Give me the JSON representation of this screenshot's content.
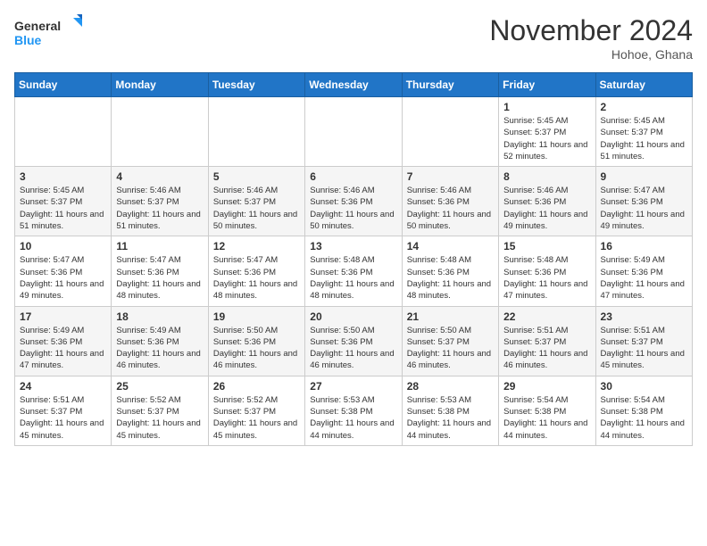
{
  "header": {
    "logo_line1": "General",
    "logo_line2": "Blue",
    "month_title": "November 2024",
    "location": "Hohoe, Ghana"
  },
  "weekdays": [
    "Sunday",
    "Monday",
    "Tuesday",
    "Wednesday",
    "Thursday",
    "Friday",
    "Saturday"
  ],
  "weeks": [
    [
      {
        "day": "",
        "sunrise": "",
        "sunset": "",
        "daylight": ""
      },
      {
        "day": "",
        "sunrise": "",
        "sunset": "",
        "daylight": ""
      },
      {
        "day": "",
        "sunrise": "",
        "sunset": "",
        "daylight": ""
      },
      {
        "day": "",
        "sunrise": "",
        "sunset": "",
        "daylight": ""
      },
      {
        "day": "",
        "sunrise": "",
        "sunset": "",
        "daylight": ""
      },
      {
        "day": "1",
        "sunrise": "Sunrise: 5:45 AM",
        "sunset": "Sunset: 5:37 PM",
        "daylight": "Daylight: 11 hours and 52 minutes."
      },
      {
        "day": "2",
        "sunrise": "Sunrise: 5:45 AM",
        "sunset": "Sunset: 5:37 PM",
        "daylight": "Daylight: 11 hours and 51 minutes."
      }
    ],
    [
      {
        "day": "3",
        "sunrise": "Sunrise: 5:45 AM",
        "sunset": "Sunset: 5:37 PM",
        "daylight": "Daylight: 11 hours and 51 minutes."
      },
      {
        "day": "4",
        "sunrise": "Sunrise: 5:46 AM",
        "sunset": "Sunset: 5:37 PM",
        "daylight": "Daylight: 11 hours and 51 minutes."
      },
      {
        "day": "5",
        "sunrise": "Sunrise: 5:46 AM",
        "sunset": "Sunset: 5:37 PM",
        "daylight": "Daylight: 11 hours and 50 minutes."
      },
      {
        "day": "6",
        "sunrise": "Sunrise: 5:46 AM",
        "sunset": "Sunset: 5:36 PM",
        "daylight": "Daylight: 11 hours and 50 minutes."
      },
      {
        "day": "7",
        "sunrise": "Sunrise: 5:46 AM",
        "sunset": "Sunset: 5:36 PM",
        "daylight": "Daylight: 11 hours and 50 minutes."
      },
      {
        "day": "8",
        "sunrise": "Sunrise: 5:46 AM",
        "sunset": "Sunset: 5:36 PM",
        "daylight": "Daylight: 11 hours and 49 minutes."
      },
      {
        "day": "9",
        "sunrise": "Sunrise: 5:47 AM",
        "sunset": "Sunset: 5:36 PM",
        "daylight": "Daylight: 11 hours and 49 minutes."
      }
    ],
    [
      {
        "day": "10",
        "sunrise": "Sunrise: 5:47 AM",
        "sunset": "Sunset: 5:36 PM",
        "daylight": "Daylight: 11 hours and 49 minutes."
      },
      {
        "day": "11",
        "sunrise": "Sunrise: 5:47 AM",
        "sunset": "Sunset: 5:36 PM",
        "daylight": "Daylight: 11 hours and 48 minutes."
      },
      {
        "day": "12",
        "sunrise": "Sunrise: 5:47 AM",
        "sunset": "Sunset: 5:36 PM",
        "daylight": "Daylight: 11 hours and 48 minutes."
      },
      {
        "day": "13",
        "sunrise": "Sunrise: 5:48 AM",
        "sunset": "Sunset: 5:36 PM",
        "daylight": "Daylight: 11 hours and 48 minutes."
      },
      {
        "day": "14",
        "sunrise": "Sunrise: 5:48 AM",
        "sunset": "Sunset: 5:36 PM",
        "daylight": "Daylight: 11 hours and 48 minutes."
      },
      {
        "day": "15",
        "sunrise": "Sunrise: 5:48 AM",
        "sunset": "Sunset: 5:36 PM",
        "daylight": "Daylight: 11 hours and 47 minutes."
      },
      {
        "day": "16",
        "sunrise": "Sunrise: 5:49 AM",
        "sunset": "Sunset: 5:36 PM",
        "daylight": "Daylight: 11 hours and 47 minutes."
      }
    ],
    [
      {
        "day": "17",
        "sunrise": "Sunrise: 5:49 AM",
        "sunset": "Sunset: 5:36 PM",
        "daylight": "Daylight: 11 hours and 47 minutes."
      },
      {
        "day": "18",
        "sunrise": "Sunrise: 5:49 AM",
        "sunset": "Sunset: 5:36 PM",
        "daylight": "Daylight: 11 hours and 46 minutes."
      },
      {
        "day": "19",
        "sunrise": "Sunrise: 5:50 AM",
        "sunset": "Sunset: 5:36 PM",
        "daylight": "Daylight: 11 hours and 46 minutes."
      },
      {
        "day": "20",
        "sunrise": "Sunrise: 5:50 AM",
        "sunset": "Sunset: 5:36 PM",
        "daylight": "Daylight: 11 hours and 46 minutes."
      },
      {
        "day": "21",
        "sunrise": "Sunrise: 5:50 AM",
        "sunset": "Sunset: 5:37 PM",
        "daylight": "Daylight: 11 hours and 46 minutes."
      },
      {
        "day": "22",
        "sunrise": "Sunrise: 5:51 AM",
        "sunset": "Sunset: 5:37 PM",
        "daylight": "Daylight: 11 hours and 46 minutes."
      },
      {
        "day": "23",
        "sunrise": "Sunrise: 5:51 AM",
        "sunset": "Sunset: 5:37 PM",
        "daylight": "Daylight: 11 hours and 45 minutes."
      }
    ],
    [
      {
        "day": "24",
        "sunrise": "Sunrise: 5:51 AM",
        "sunset": "Sunset: 5:37 PM",
        "daylight": "Daylight: 11 hours and 45 minutes."
      },
      {
        "day": "25",
        "sunrise": "Sunrise: 5:52 AM",
        "sunset": "Sunset: 5:37 PM",
        "daylight": "Daylight: 11 hours and 45 minutes."
      },
      {
        "day": "26",
        "sunrise": "Sunrise: 5:52 AM",
        "sunset": "Sunset: 5:37 PM",
        "daylight": "Daylight: 11 hours and 45 minutes."
      },
      {
        "day": "27",
        "sunrise": "Sunrise: 5:53 AM",
        "sunset": "Sunset: 5:38 PM",
        "daylight": "Daylight: 11 hours and 44 minutes."
      },
      {
        "day": "28",
        "sunrise": "Sunrise: 5:53 AM",
        "sunset": "Sunset: 5:38 PM",
        "daylight": "Daylight: 11 hours and 44 minutes."
      },
      {
        "day": "29",
        "sunrise": "Sunrise: 5:54 AM",
        "sunset": "Sunset: 5:38 PM",
        "daylight": "Daylight: 11 hours and 44 minutes."
      },
      {
        "day": "30",
        "sunrise": "Sunrise: 5:54 AM",
        "sunset": "Sunset: 5:38 PM",
        "daylight": "Daylight: 11 hours and 44 minutes."
      }
    ]
  ]
}
